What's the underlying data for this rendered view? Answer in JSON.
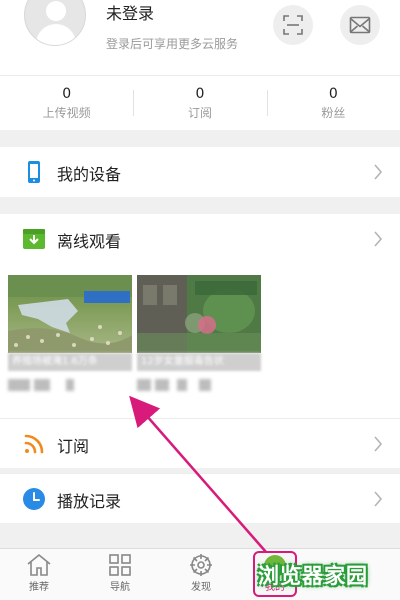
{
  "header": {
    "login_title": "未登录",
    "login_subtitle": "登录后可享用更多云服务"
  },
  "stats": [
    {
      "value": "0",
      "label": "上传视频"
    },
    {
      "value": "0",
      "label": "订阅"
    },
    {
      "value": "0",
      "label": "粉丝"
    }
  ],
  "menu": {
    "my_devices": "我的设备",
    "offline_viewing": "离线观看",
    "subscriptions": "订阅",
    "play_history": "播放记录"
  },
  "offline_videos": [
    {
      "title": "养殖场被淹1.6万条"
    },
    {
      "title": "12岁女童服毒告状"
    }
  ],
  "bottom_nav": [
    {
      "label": "推荐",
      "icon": "home-icon"
    },
    {
      "label": "导航",
      "icon": "grid-icon"
    },
    {
      "label": "发现",
      "icon": "compass-icon"
    },
    {
      "label": "我的",
      "icon": "user-icon"
    }
  ],
  "watermark": "浏览器家园",
  "colors": {
    "accent_magenta": "#d81b7a",
    "device_blue": "#1a8fe0",
    "offline_green": "#5cb82e",
    "rss_orange": "#f08a1c",
    "history_blue": "#2a8be6"
  }
}
